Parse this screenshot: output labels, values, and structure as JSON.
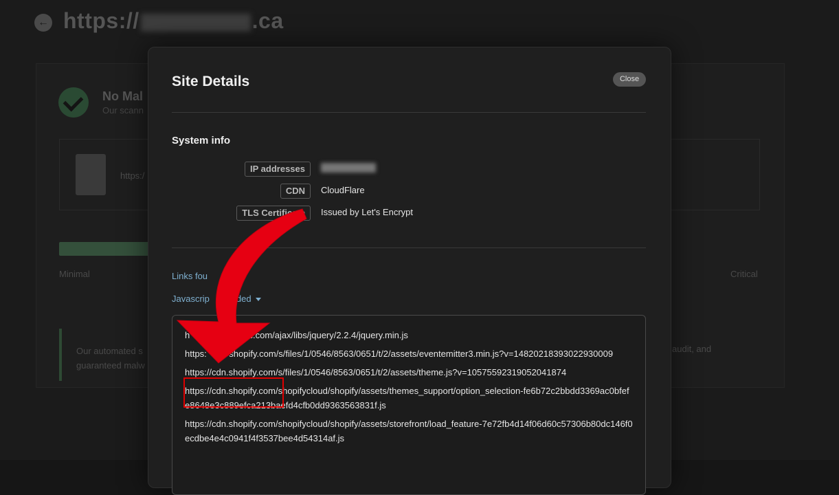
{
  "background": {
    "page_title_prefix": "https://",
    "page_title_suffix": ".ca",
    "status_title": "No Mal",
    "status_sub": "Our scann",
    "url_snippet": "https:/",
    "risk_minimal": "Minimal",
    "risk_critical": "Critical",
    "footer_left_1": "Our automated s",
    "footer_left_2": "guaranteed malw",
    "footer_right": "audit, and"
  },
  "modal": {
    "title": "Site Details",
    "close_label": "Close",
    "system_info_title": "System info",
    "rows": [
      {
        "label": "IP addresses",
        "value": ""
      },
      {
        "label": "CDN",
        "value": "CloudFlare"
      },
      {
        "label": "TLS Certificate",
        "value": "Issued by Let's Encrypt"
      }
    ],
    "links_found": "Links fou",
    "javascript_included": "Javascrip        luded",
    "js_urls": [
      "h              gleapis.com/ajax/libs/jquery/2.2.4/jquery.min.js",
      "https:         shopify.com/s/files/1/0546/8563/0651/t/2/assets/eventemitter3.min.js?v=14820218393022930009",
      "https://cdn.shopify.com/s/files/1/0546/8563/0651/t/2/assets/theme.js?v=10575592319052041874",
      "https://cdn.shopify.com/shopifycloud/shopify/assets/themes_support/option_selection-fe6b72c2bbdd3369ac0bfefe8648e3c889efca213baefd4cfb0dd9363563831f.js",
      "https://cdn.shopify.com/shopifycloud/shopify/assets/storefront/load_feature-7e72fb4d14f06d60c57306b80dc146f0ecdbe4e4c0941f4f3537bee4d54314af.js"
    ]
  },
  "colors": {
    "annotation_red": "#e60012",
    "link_blue": "#7fb0d0"
  }
}
